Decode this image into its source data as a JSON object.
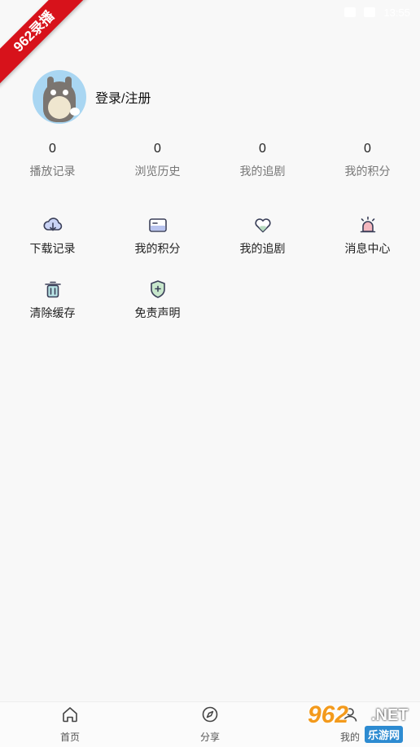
{
  "status_bar": {
    "time": "13:55"
  },
  "corner_badge": "962录播",
  "profile": {
    "login_label": "登录/注册"
  },
  "stats": [
    {
      "value": "0",
      "label": "播放记录"
    },
    {
      "value": "0",
      "label": "浏览历史"
    },
    {
      "value": "0",
      "label": "我的追剧"
    },
    {
      "value": "0",
      "label": "我的积分"
    }
  ],
  "menu": [
    {
      "label": "下载记录",
      "icon": "cloud-download-icon"
    },
    {
      "label": "我的积分",
      "icon": "card-icon"
    },
    {
      "label": "我的追剧",
      "icon": "heart-icon"
    },
    {
      "label": "消息中心",
      "icon": "alarm-icon"
    },
    {
      "label": "清除缓存",
      "icon": "trash-icon"
    },
    {
      "label": "免责声明",
      "icon": "shield-icon"
    }
  ],
  "tabbar": [
    {
      "label": "首页",
      "icon": "home-icon"
    },
    {
      "label": "分享",
      "icon": "compass-icon"
    },
    {
      "label": "我的",
      "icon": "user-icon"
    }
  ],
  "watermark": {
    "brand": "962",
    "domain": ".NET",
    "sub": "乐游网"
  }
}
